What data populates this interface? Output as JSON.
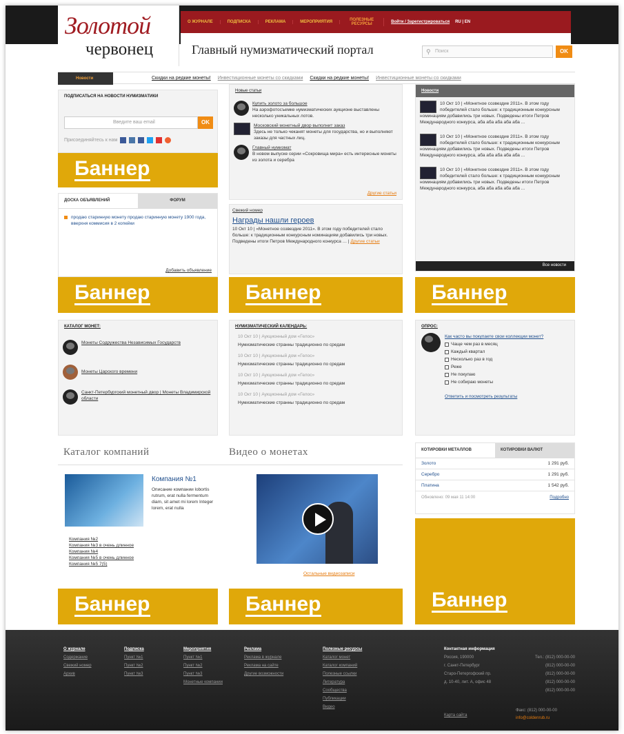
{
  "brand": {
    "logo_line1": "Золотой",
    "logo_line2": "червонец",
    "portal_title": "Главный нумизматический портал"
  },
  "menu": {
    "items": [
      "О журнале",
      "Подписка",
      "Реклама",
      "Мероприятия",
      "Полезные ресурсы"
    ],
    "login": "Войти / Зарегистрироваться",
    "lang": "RU | EN"
  },
  "search": {
    "placeholder": "Поиск",
    "ok": "OK"
  },
  "ticker": {
    "tab": "Новости",
    "items": [
      "Скидки на редкие монеты!",
      "Инвестиционные монеты со скидками",
      "Скидки на редкие монеты!",
      "Инвестиционные монеты со скидками"
    ]
  },
  "subscribe": {
    "title": "Подписаться на новости нумизматики",
    "placeholder": "Введите ваш email",
    "ok": "OK",
    "join": "Присоединяйтесь к нам"
  },
  "banner": "Баннер",
  "board": {
    "tab1": "Доска объявлений",
    "tab2": "Форум",
    "text": "продаю старинную монету продаю старинную монету 1900 года, вверхня коммисия в 2 копейки",
    "more": "Добавить объявление"
  },
  "articles": {
    "title": "Новые статьи",
    "items": [
      {
        "link": "Купить золото за большое",
        "text": "На аэрофотосъемке нумизматических аукционе выставлены несколько уникальных лотов."
      },
      {
        "link": "Московский монетный двор выполнит заказ",
        "text": "Здесь не только чеканят монеты для государства, но и выполняют заказы для частных лиц."
      },
      {
        "link": "Главный нумизмат",
        "text": "В новом выпуске серии «Сокровища мира» есть интересные монеты из золота и серебра"
      }
    ],
    "more": "Другие статьи"
  },
  "recent": {
    "title": "Свежий номер",
    "headline": "Награды нашли героев",
    "text": "10 Окт 10 | «Монетное созвездие 2011». В этом году победителей стало больше: к традиционным конкурсным номинациям добавились три новых. Подведены итоги Петров Международного конкурса … | ",
    "more": "Другие статьи"
  },
  "news": {
    "title": "Новости",
    "items": [
      "10 Окт 10 | «Монетное созвездие 2011». В этом году победителей стало больше: к традиционным конкурсным номинациям добавились три новых. Подведены итоги Петров Международного конкурса, аба аба аба аба аба ...",
      "10 Окт 10 | «Монетное созвездие 2011». В этом году победителей стало больше: к традиционным конкурсным номинациям добавились три новых. Подведены итоги Петров Международного конкурса, аба аба аба аба аба ...",
      "10 Окт 10 | «Монетное созвездие 2011». В этом году победителей стало больше: к традиционным конкурсным номинациям добавились три новых. Подведены итоги Петров Международного конкурса, аба аба аба аба аба ..."
    ],
    "more": "Все новости"
  },
  "catalog": {
    "title": "Каталог монет:",
    "items": [
      "Монеты Содружества Независимых Государств",
      "Монеты Царского времени",
      "Санкт-Петербургский монетный двор | Монеты Владимирской области"
    ]
  },
  "calendar": {
    "title": "Нумизматический календарь:",
    "date": "10 Окт 10 | Аукционный дом «Гелос»",
    "text": "Нумизматические странны традиционно по средам"
  },
  "poll": {
    "title": "Опрос:",
    "question": "Как часто вы покупаете свои коллекции монет?",
    "options": [
      "Чаще чем раз в месяц",
      "Каждый квартал",
      "Несколько раз в год",
      "Реже",
      "Не покупаю",
      "Не собираю монеты"
    ],
    "vote": "Ответить и посмотреть результаты"
  },
  "companies": {
    "title": "Каталог компаний",
    "name": "Компания №1",
    "desc": "Описание компании lobortis rutrum, erat nulla fermentum diam, sit amet mi lorem Integer lorem, erat nulla",
    "list": [
      "Компания №2",
      "Компания №3 в очень длинное",
      "Компания №4",
      "Компания №5 в очень длинное",
      "Компания №5 7(5)"
    ]
  },
  "video": {
    "title": "Видео о монетах",
    "more": "Остальные видеозаписи"
  },
  "quotes": {
    "tab1": "Котировки металлов",
    "tab2": "Котировки валют",
    "rows": [
      {
        "name": "Золото",
        "price": "1 291 руб."
      },
      {
        "name": "Серебро",
        "price": "1 291 руб."
      },
      {
        "name": "Платина",
        "price": "1 542 руб."
      }
    ],
    "updated": "Обновлено: 09 мая 11 14:00",
    "more": "Подробно"
  },
  "footer": {
    "cols": [
      {
        "h": "О журнале",
        "items": [
          "Содержание",
          "Свежий номер",
          "Архив"
        ]
      },
      {
        "h": "Подписка",
        "items": [
          "Пункт №1",
          "Пункт №2",
          "Пункт №3"
        ]
      },
      {
        "h": "Мероприятия",
        "items": [
          "Пункт №1",
          "Пункт №2",
          "Пункт №3",
          "Монетные компании"
        ]
      },
      {
        "h": "Реклама",
        "items": [
          "Реклама в журнале",
          "Реклама на сайте",
          "Другие возможности"
        ]
      },
      {
        "h": "Полезные ресурсы",
        "items": [
          "Каталог монет",
          "Каталог компаний",
          "Полезные ссылки",
          "Литература",
          "Сообщества",
          "Публикации",
          "Видео"
        ]
      }
    ],
    "contact_title": "Контактная информация",
    "contact": [
      "Россия, 190000",
      "г. Санкт-Петербург",
      "Старо-Петергофский пр.",
      "д. 10-40, лит. А, офис 48"
    ],
    "phones": [
      "Тел.: (812) 000-00-00",
      "(812) 000-00-00",
      "(812) 000-00-00",
      "(812) 000-00-00",
      "(812) 000-00-00"
    ],
    "sitemap": "Карта сайта",
    "fax": "Факс: (812) 000-00-00",
    "email": "info@coldenrub.ru"
  }
}
